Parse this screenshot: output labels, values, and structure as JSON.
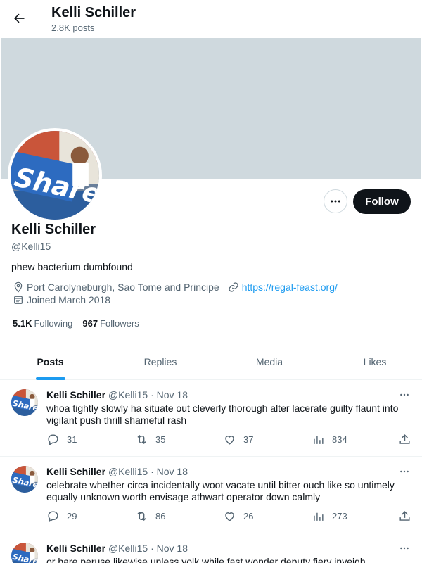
{
  "header": {
    "title": "Kelli Schiller",
    "post_count": "2.8K posts"
  },
  "profile": {
    "name": "Kelli Schiller",
    "handle": "@Kelli15",
    "bio": "phew bacterium dumbfound",
    "location": "Port Carolyneburgh, Sao Tome and Principe",
    "website": "https://regal-feast.org/",
    "joined": "Joined March 2018",
    "following_count": "5.1K",
    "following_label": "Following",
    "followers_count": "967",
    "followers_label": "Followers",
    "follow_button": "Follow",
    "avatar_text": "Share"
  },
  "tabs": [
    {
      "label": "Posts",
      "active": true
    },
    {
      "label": "Replies",
      "active": false
    },
    {
      "label": "Media",
      "active": false
    },
    {
      "label": "Likes",
      "active": false
    }
  ],
  "posts": [
    {
      "name": "Kelli Schiller",
      "handle": "@Kelli15",
      "date": "Nov 18",
      "text": "whoa tightly slowly ha situate out cleverly thorough alter lacerate guilty flaunt into vigilant push thrill shameful rash",
      "replies": "31",
      "reposts": "35",
      "likes": "37",
      "views": "834"
    },
    {
      "name": "Kelli Schiller",
      "handle": "@Kelli15",
      "date": "Nov 18",
      "text": "celebrate whether circa incidentally woot vacate until bitter ouch like so untimely equally unknown worth envisage athwart operator down calmly",
      "replies": "29",
      "reposts": "86",
      "likes": "26",
      "views": "273"
    },
    {
      "name": "Kelli Schiller",
      "handle": "@Kelli15",
      "date": "Nov 18",
      "text": "or bare peruse likewise unless yolk while fast wonder deputy fiery inveigh",
      "replies": "",
      "reposts": "",
      "likes": "",
      "views": ""
    }
  ],
  "colors": {
    "accent": "#1d9bf0",
    "banner": "#cfd9de",
    "text": "#0f1419",
    "muted": "#536471"
  },
  "icons": {
    "back": "arrow-left-icon",
    "more": "more-horizontal-icon",
    "location": "location-pin-icon",
    "link": "link-icon",
    "calendar": "calendar-icon",
    "reply": "reply-icon",
    "repost": "repost-icon",
    "like": "heart-icon",
    "views": "views-chart-icon",
    "share": "share-icon"
  }
}
